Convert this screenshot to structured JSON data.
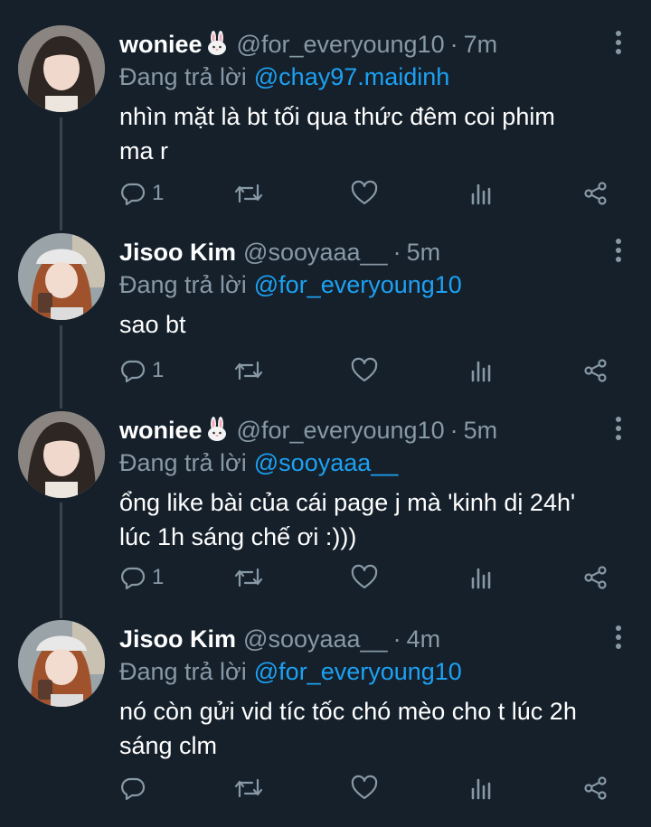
{
  "tweets": [
    {
      "name": "woniee",
      "name_emoji": "rabbit-emoji",
      "handle": "@for_everyoung10",
      "separator": "·",
      "time": "7m",
      "reply_label": "Đang trả lời",
      "reply_to": "@chay97.maidinh",
      "lines": [
        "nhìn mặt là bt tối qua thức đêm coi phim",
        "ma r"
      ],
      "reply_count": "1"
    },
    {
      "name": "Jisoo Kim",
      "name_emoji": "",
      "handle": "@sooyaaa__",
      "separator": "·",
      "time": "5m",
      "reply_label": "Đang trả lời",
      "reply_to": "@for_everyoung10",
      "lines": [
        "sao bt"
      ],
      "reply_count": "1"
    },
    {
      "name": "woniee",
      "name_emoji": "rabbit-emoji",
      "handle": "@for_everyoung10",
      "separator": "·",
      "time": "5m",
      "reply_label": "Đang trả lời",
      "reply_to": "@sooyaaa__",
      "lines": [
        "ổng like bài của cái page j mà 'kinh dị 24h'",
        "lúc 1h sáng chế ơi :)))"
      ],
      "reply_count": "1"
    },
    {
      "name": "Jisoo Kim",
      "name_emoji": "",
      "handle": "@sooyaaa__",
      "separator": "·",
      "time": "4m",
      "reply_label": "Đang trả lời",
      "reply_to": "@for_everyoung10",
      "lines": [
        "nó còn gửi vid tíc tốc chó mèo cho t lúc 2h",
        "sáng clm"
      ],
      "reply_count": ""
    }
  ],
  "icons": [
    "reply-icon",
    "retweet-icon",
    "like-icon",
    "stats-icon",
    "share-icon",
    "more-icon"
  ],
  "colors": {
    "background": "#15202b",
    "text": "#ffffff",
    "muted": "#8899a6",
    "link": "#1da1f2",
    "thread_line": "#38444d"
  }
}
